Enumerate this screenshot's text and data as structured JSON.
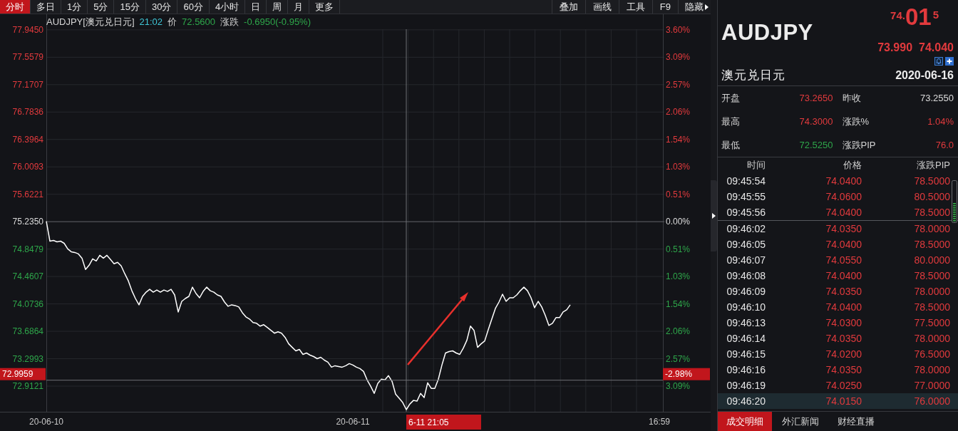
{
  "toolbar": {
    "periods": [
      {
        "label": "分时",
        "selected": true
      },
      {
        "label": "多日",
        "selected": false
      },
      {
        "label": "1分",
        "selected": false
      },
      {
        "label": "5分",
        "selected": false
      },
      {
        "label": "15分",
        "selected": false
      },
      {
        "label": "30分",
        "selected": false
      },
      {
        "label": "60分",
        "selected": false
      },
      {
        "label": "4小时",
        "selected": false
      },
      {
        "label": "日",
        "selected": false
      },
      {
        "label": "周",
        "selected": false
      },
      {
        "label": "月",
        "selected": false
      },
      {
        "label": "更多",
        "selected": false
      }
    ],
    "tools": [
      {
        "label": "叠加",
        "kind": "plain"
      },
      {
        "label": "画线",
        "kind": "plain"
      },
      {
        "label": "工具",
        "kind": "plain"
      },
      {
        "label": "F9",
        "kind": "plain"
      },
      {
        "label": "隐藏",
        "kind": "collapse"
      }
    ]
  },
  "chart": {
    "info": {
      "symbol": "AUDJPY[澳元兑日元]",
      "time": "21:02",
      "price_caption": "价",
      "price": "72.5600",
      "change_caption": "涨跌",
      "change": "-0.6950(-0.95%)",
      "falling": true
    },
    "percent_axis": [
      {
        "label": "3.60%",
        "color": "#e23a3d"
      },
      {
        "label": "3.09%",
        "color": "#e23a3d"
      },
      {
        "label": "2.57%",
        "color": "#e23a3d"
      },
      {
        "label": "2.06%",
        "color": "#e23a3d"
      },
      {
        "label": "1.54%",
        "color": "#e23a3d"
      },
      {
        "label": "1.03%",
        "color": "#e23a3d"
      },
      {
        "label": "0.51%",
        "color": "#e23a3d"
      },
      {
        "label": "0.00%",
        "color": "#dcdcdc"
      },
      {
        "label": "0.51%",
        "color": "#2ea64a"
      },
      {
        "label": "1.03%",
        "color": "#2ea64a"
      },
      {
        "label": "1.54%",
        "color": "#2ea64a"
      },
      {
        "label": "2.06%",
        "color": "#2ea64a"
      },
      {
        "label": "2.57%",
        "color": "#2ea64a"
      },
      {
        "label": "3.09%",
        "color": "#2ea64a"
      }
    ],
    "crosshair_percent": "-2.98%",
    "crosshair_time": "6-11 21:05",
    "chart_data": {
      "type": "line",
      "grid": true,
      "categories": [
        "20-06-10",
        null,
        null,
        null,
        null,
        null,
        null,
        null,
        null,
        null,
        null,
        null,
        null,
        null,
        null,
        null,
        null,
        null,
        null,
        null,
        null,
        null,
        null,
        null,
        null,
        null,
        null,
        null,
        null,
        null,
        null,
        null,
        null,
        null,
        null,
        null,
        null,
        null,
        null,
        null,
        null,
        null,
        null,
        null,
        null,
        null,
        null,
        null,
        null,
        null,
        null,
        null,
        null,
        null,
        null,
        null,
        null,
        null,
        null,
        null,
        null,
        null,
        null,
        null,
        null,
        null,
        null,
        null,
        null,
        null,
        null,
        null,
        null,
        null,
        null,
        null,
        null,
        null,
        null,
        null,
        null,
        null,
        null,
        null,
        null,
        null,
        "20-06-11",
        null,
        null,
        null,
        null,
        null,
        null,
        null,
        null,
        null,
        null,
        null,
        null,
        null,
        null,
        null,
        null,
        null,
        null,
        null,
        null,
        null,
        null,
        null,
        null,
        null,
        null,
        null,
        null,
        null,
        null,
        null,
        null,
        null,
        null,
        null,
        null,
        null,
        null,
        null,
        null,
        null,
        null,
        null,
        null,
        null,
        null,
        null,
        null,
        null,
        null,
        null,
        null,
        null,
        null,
        null,
        null,
        null,
        null,
        null,
        null,
        null,
        null,
        null,
        null,
        null,
        null,
        null,
        null,
        null,
        null,
        null,
        null,
        null,
        null,
        null,
        null,
        null,
        null,
        null,
        null,
        null,
        null,
        null,
        null,
        null,
        "16:59",
        null
      ],
      "series": [
        {
          "color": "#ffffff",
          "values": [
            75.24,
            74.96,
            74.97,
            74.95,
            74.96,
            74.93,
            74.85,
            74.81,
            74.8,
            74.78,
            74.72,
            74.56,
            74.62,
            74.71,
            74.68,
            74.76,
            74.72,
            74.76,
            74.7,
            74.64,
            74.66,
            74.61,
            74.5,
            74.4,
            74.26,
            74.15,
            74.06,
            74.18,
            74.24,
            74.28,
            74.24,
            74.27,
            74.24,
            74.27,
            74.25,
            74.28,
            74.2,
            73.96,
            74.11,
            74.15,
            74.18,
            74.31,
            74.22,
            74.16,
            74.25,
            74.31,
            74.26,
            74.24,
            74.2,
            74.18,
            74.1,
            74.04,
            74.06,
            74.05,
            74.03,
            73.95,
            73.89,
            73.86,
            73.81,
            73.8,
            73.76,
            73.78,
            73.74,
            73.7,
            73.66,
            73.68,
            73.66,
            73.6,
            73.51,
            73.46,
            73.41,
            73.43,
            73.36,
            73.38,
            73.35,
            73.33,
            73.3,
            73.32,
            73.28,
            73.25,
            73.18,
            73.2,
            73.19,
            73.18,
            73.2,
            73.23,
            73.21,
            73.18,
            73.16,
            73.12,
            73.0,
            72.91,
            72.81,
            72.95,
            73.01,
            73.0,
            73.06,
            72.98,
            72.8,
            72.74,
            72.68,
            72.58,
            72.66,
            72.71,
            72.7,
            72.81,
            72.75,
            72.96,
            72.88,
            72.88,
            73.01,
            73.21,
            73.38,
            73.4,
            73.41,
            73.38,
            73.36,
            73.45,
            73.56,
            73.76,
            73.7,
            73.46,
            73.51,
            73.55,
            73.71,
            73.86,
            74.01,
            74.1,
            74.21,
            74.11,
            74.16,
            74.16,
            74.2,
            74.26,
            74.31,
            74.26,
            74.16,
            74.02,
            74.11,
            74.03,
            73.91,
            73.77,
            73.8,
            73.88,
            73.88,
            73.96,
            73.99,
            74.06,
            null,
            null,
            null,
            null,
            null,
            null,
            null,
            null,
            null,
            null,
            null,
            null,
            null,
            null,
            null,
            null,
            null,
            null,
            null,
            null,
            null,
            null,
            null,
            null,
            null,
            null
          ]
        }
      ],
      "ylim": [
        72.55,
        78.165
      ],
      "yticks": [
        {
          "value": 77.945,
          "label": "77.9450"
        },
        {
          "value": 77.5579,
          "label": "77.5579"
        },
        {
          "value": 77.1707,
          "label": "77.1707"
        },
        {
          "value": 76.7836,
          "label": "76.7836"
        },
        {
          "value": 76.3964,
          "label": "76.3964"
        },
        {
          "value": 76.0093,
          "label": "76.0093"
        },
        {
          "value": 75.6221,
          "label": "75.6221"
        },
        {
          "value": 75.235,
          "label": "75.2350"
        },
        {
          "value": 74.8479,
          "label": "74.8479"
        },
        {
          "value": 74.4607,
          "label": "74.4607"
        },
        {
          "value": 74.0736,
          "label": "74.0736"
        },
        {
          "value": 73.6864,
          "label": "73.6864"
        },
        {
          "value": 73.2993,
          "label": "73.2993"
        },
        {
          "value": 72.9121,
          "label": "72.9121"
        }
      ],
      "ref_lines": [
        {
          "axis": "y",
          "value": 75.235
        },
        {
          "axis": "y",
          "value": 72.9959,
          "label": "72.9959"
        }
      ]
    }
  },
  "side_panel": {
    "symbol": "AUDJPY",
    "quote": {
      "prefix": "74.",
      "pips": "01",
      "fraction": "5"
    },
    "bid": "73.990",
    "ask": "74.040",
    "name": "澳元兑日元",
    "date": "2020-06-16",
    "stats": [
      {
        "label": "开盘",
        "value": "73.2650",
        "color": "#e23a3d"
      },
      {
        "label": "昨收",
        "value": "73.2550",
        "color": "#dcdcdc"
      },
      {
        "label": "最高",
        "value": "74.3000",
        "color": "#e23a3d"
      },
      {
        "label": "涨跌%",
        "value": "1.04%",
        "color": "#e23a3d"
      },
      {
        "label": "最低",
        "value": "72.5250",
        "color": "#2ea64a"
      },
      {
        "label": "涨跌PIP",
        "value": "76.0",
        "color": "#e23a3d"
      }
    ],
    "trades": {
      "columns": [
        "时间",
        "价格",
        "涨跌PIP"
      ],
      "rows": [
        {
          "time": "09:45:54",
          "price": "74.0400",
          "change": "78.5000",
          "divider_below": false,
          "selected": false
        },
        {
          "time": "09:45:55",
          "price": "74.0600",
          "change": "80.5000",
          "divider_below": false,
          "selected": false
        },
        {
          "time": "09:45:56",
          "price": "74.0400",
          "change": "78.5000",
          "divider_below": true,
          "selected": false
        },
        {
          "time": "09:46:02",
          "price": "74.0350",
          "change": "78.0000",
          "divider_below": false,
          "selected": false
        },
        {
          "time": "09:46:05",
          "price": "74.0400",
          "change": "78.5000",
          "divider_below": false,
          "selected": false
        },
        {
          "time": "09:46:07",
          "price": "74.0550",
          "change": "80.0000",
          "divider_below": false,
          "selected": false
        },
        {
          "time": "09:46:08",
          "price": "74.0400",
          "change": "78.5000",
          "divider_below": false,
          "selected": false
        },
        {
          "time": "09:46:09",
          "price": "74.0350",
          "change": "78.0000",
          "divider_below": false,
          "selected": false
        },
        {
          "time": "09:46:10",
          "price": "74.0400",
          "change": "78.5000",
          "divider_below": false,
          "selected": false
        },
        {
          "time": "09:46:13",
          "price": "74.0300",
          "change": "77.5000",
          "divider_below": false,
          "selected": false
        },
        {
          "time": "09:46:14",
          "price": "74.0350",
          "change": "78.0000",
          "divider_below": false,
          "selected": false
        },
        {
          "time": "09:46:15",
          "price": "74.0200",
          "change": "76.5000",
          "divider_below": false,
          "selected": false
        },
        {
          "time": "09:46:16",
          "price": "74.0350",
          "change": "78.0000",
          "divider_below": false,
          "selected": false
        },
        {
          "time": "09:46:19",
          "price": "74.0250",
          "change": "77.0000",
          "divider_below": false,
          "selected": false
        },
        {
          "time": "09:46:20",
          "price": "74.0150",
          "change": "76.0000",
          "divider_below": false,
          "selected": true
        }
      ]
    },
    "tabs": [
      {
        "label": "成交明细",
        "selected": true
      },
      {
        "label": "外汇新闻",
        "selected": false
      },
      {
        "label": "财经直播",
        "selected": false
      }
    ]
  }
}
